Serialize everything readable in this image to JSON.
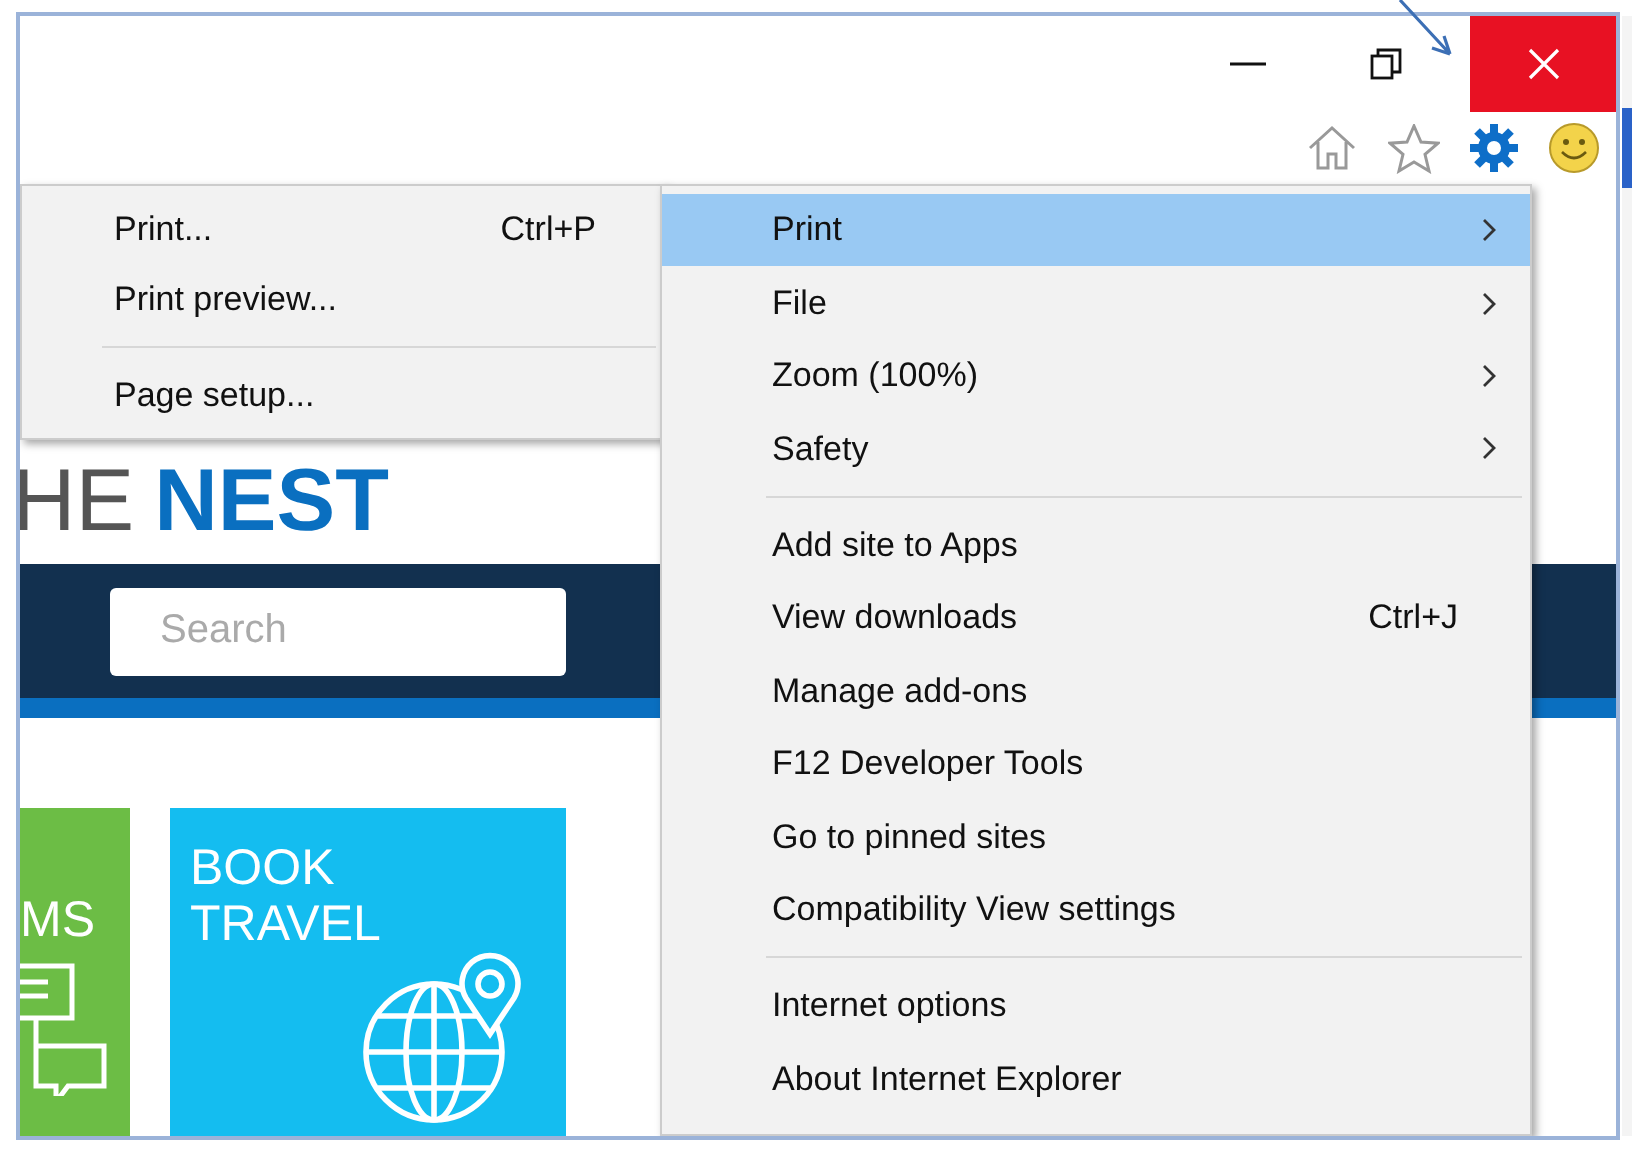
{
  "page": {
    "logo": {
      "light": "HE",
      "bold": "NEST"
    },
    "search": {
      "placeholder": "Search"
    },
    "tiles": [
      {
        "kind": "chat",
        "lines": [
          "MS"
        ],
        "color": "#6cbd45"
      },
      {
        "kind": "globe",
        "lines": [
          "BOOK",
          "TRAVEL"
        ],
        "color": "#14bdf0"
      }
    ]
  },
  "tools_menu": {
    "items": [
      {
        "kind": "item",
        "label": "Print",
        "has_submenu": true,
        "selected": true
      },
      {
        "kind": "item",
        "label": "File",
        "has_submenu": true,
        "selected": false
      },
      {
        "kind": "item",
        "label": "Zoom (100%)",
        "has_submenu": true,
        "selected": false
      },
      {
        "kind": "item",
        "label": "Safety",
        "has_submenu": true,
        "selected": false
      },
      {
        "kind": "separator"
      },
      {
        "kind": "item",
        "label": "Add site to Apps",
        "has_submenu": false,
        "selected": false
      },
      {
        "kind": "item",
        "label": "View downloads",
        "shortcut": "Ctrl+J",
        "has_submenu": false,
        "selected": false
      },
      {
        "kind": "item",
        "label": "Manage add-ons",
        "has_submenu": false,
        "selected": false
      },
      {
        "kind": "item",
        "label": "F12 Developer Tools",
        "has_submenu": false,
        "selected": false
      },
      {
        "kind": "item",
        "label": "Go to pinned sites",
        "has_submenu": false,
        "selected": false
      },
      {
        "kind": "item",
        "label": "Compatibility View settings",
        "has_submenu": false,
        "selected": false
      },
      {
        "kind": "separator"
      },
      {
        "kind": "item",
        "label": "Internet options",
        "has_submenu": false,
        "selected": false
      },
      {
        "kind": "item",
        "label": "About Internet Explorer",
        "has_submenu": false,
        "selected": false
      }
    ]
  },
  "print_submenu": {
    "items": [
      {
        "kind": "item",
        "label": "Print...",
        "shortcut": "Ctrl+P"
      },
      {
        "kind": "item",
        "label": "Print preview..."
      },
      {
        "kind": "separator"
      },
      {
        "kind": "item",
        "label": "Page setup..."
      }
    ]
  }
}
